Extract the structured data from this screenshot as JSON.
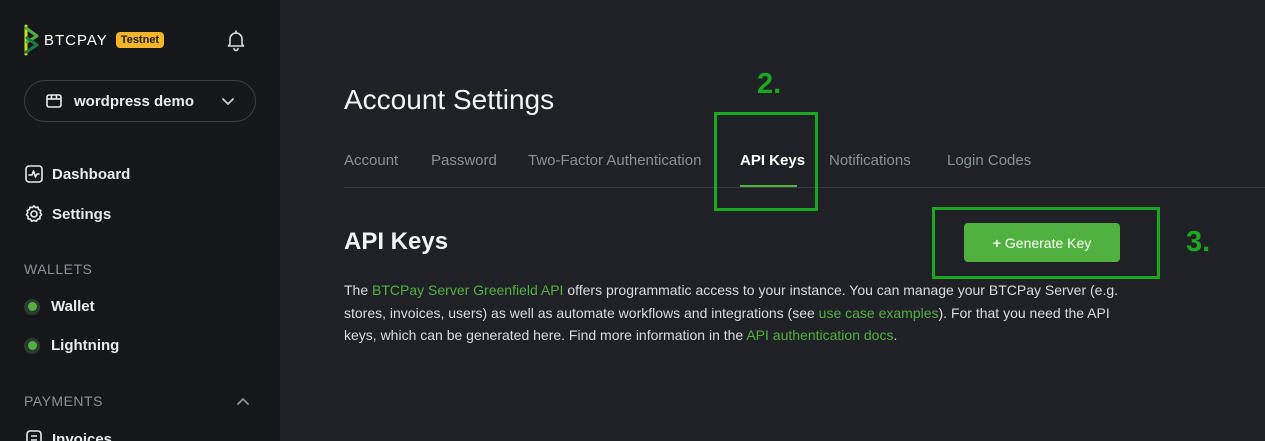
{
  "sidebar": {
    "logo_text": "BTCPAY",
    "testnet_badge": "Testnet",
    "store_name": "wordpress demo",
    "nav": {
      "dashboard": "Dashboard",
      "settings": "Settings"
    },
    "wallets_label": "WALLETS",
    "wallets": {
      "wallet": "Wallet",
      "lightning": "Lightning"
    },
    "payments_label": "PAYMENTS",
    "payments": {
      "invoices": "Invoices"
    }
  },
  "main": {
    "title": "Account Settings",
    "tabs": {
      "account": "Account",
      "password": "Password",
      "two_factor": "Two-Factor Authentication",
      "api_keys": "API Keys",
      "notifications": "Notifications",
      "login_codes": "Login Codes"
    },
    "section_title": "API Keys",
    "generate_button": "Generate Key",
    "generate_icon": "+",
    "description": {
      "part1": "The ",
      "link1": "BTCPay Server Greenfield API",
      "part2": " offers programmatic access to your instance. You can manage your BTCPay Server (e.g. stores, invoices, users) as well as automate workflows and integrations (see ",
      "link2": "use case examples",
      "part3": "). For that you need the API keys, which can be generated here. Find more information in the ",
      "link3": "API authentication docs",
      "part4": "."
    }
  },
  "annotations": {
    "step2": "2.",
    "step3": "3."
  },
  "colors": {
    "accent": "#51b13e",
    "annotation": "#1aa81f",
    "testnet": "#f5b52a"
  }
}
